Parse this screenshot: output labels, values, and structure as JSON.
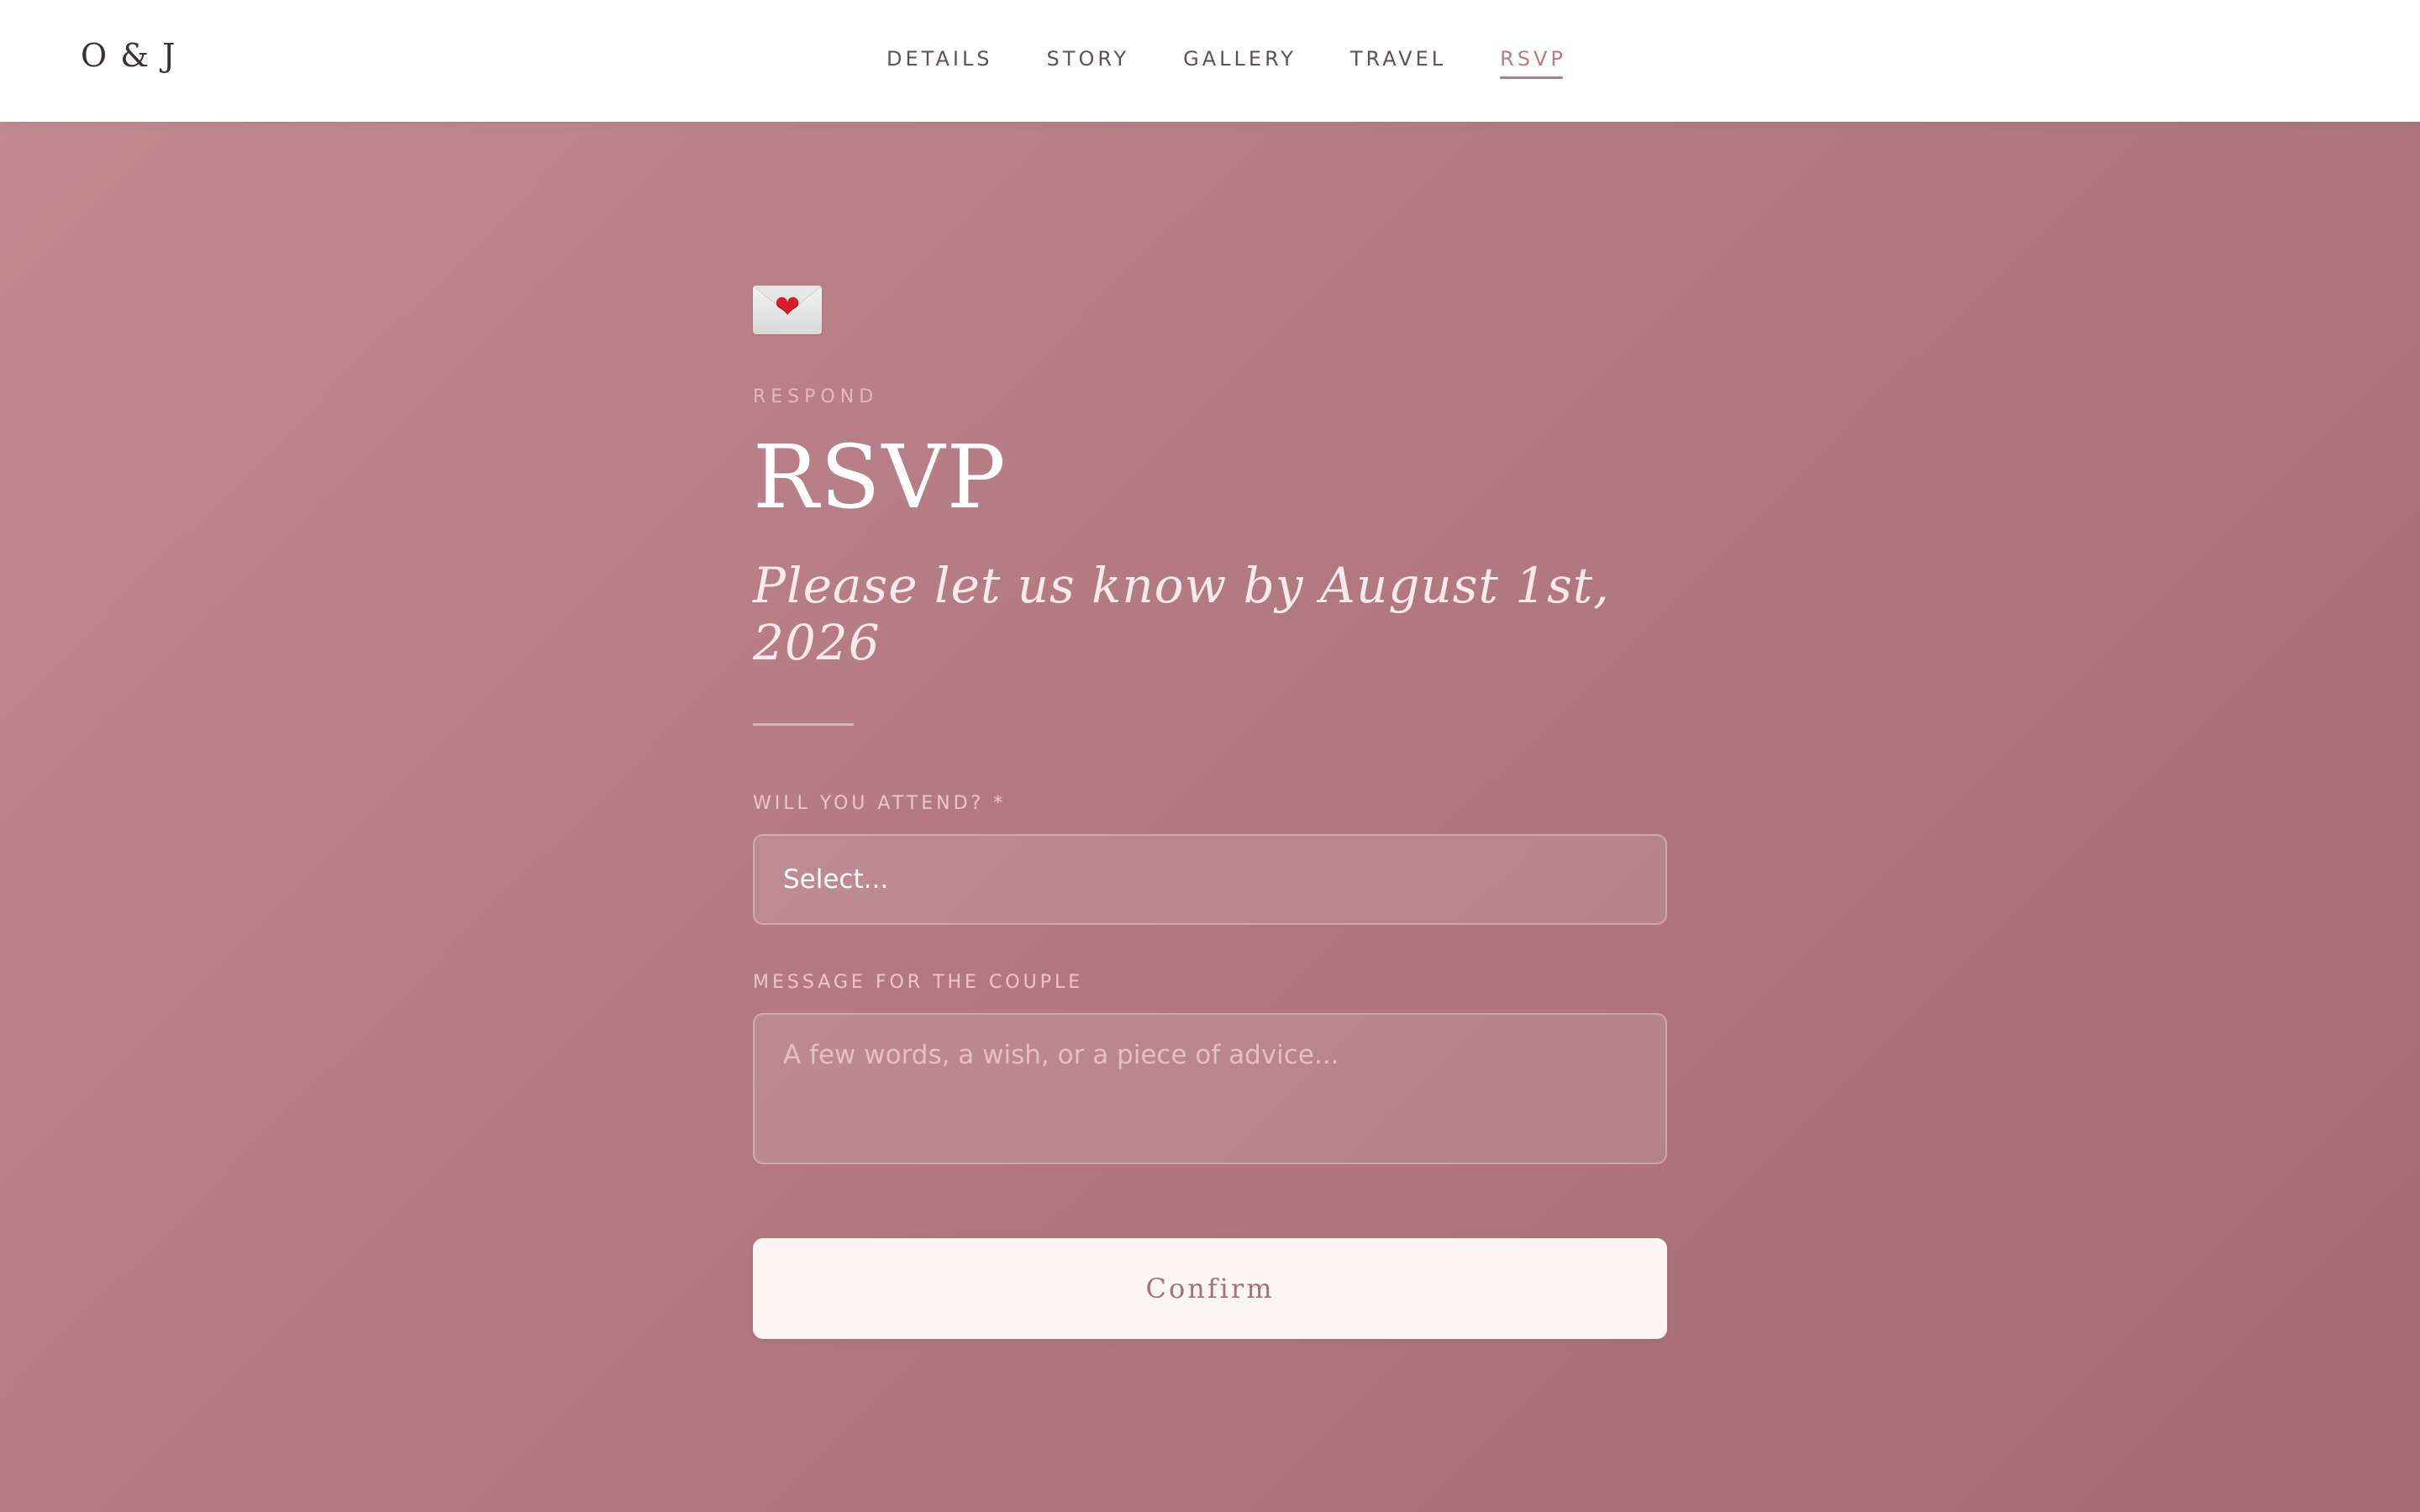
{
  "header": {
    "logo": "O & J",
    "nav": [
      {
        "label": "DETAILS"
      },
      {
        "label": "STORY"
      },
      {
        "label": "GALLERY"
      },
      {
        "label": "TRAVEL"
      },
      {
        "label": "RSVP",
        "active": true
      }
    ]
  },
  "main": {
    "icon": "love-letter-icon",
    "eyebrow": "RESPOND",
    "title": "RSVP",
    "subtitle": "Please let us know by August 1st, 2026"
  },
  "form": {
    "attend_label": "WILL YOU ATTEND? *",
    "attend_value": "Select...",
    "message_label": "MESSAGE FOR THE COUPLE",
    "message_placeholder": "A few words, a wish, or a piece of advice...",
    "submit_label": "Confirm"
  },
  "colors": {
    "accent": "#b57d84",
    "background_start": "#c48a91",
    "background_end": "#a66a72"
  }
}
